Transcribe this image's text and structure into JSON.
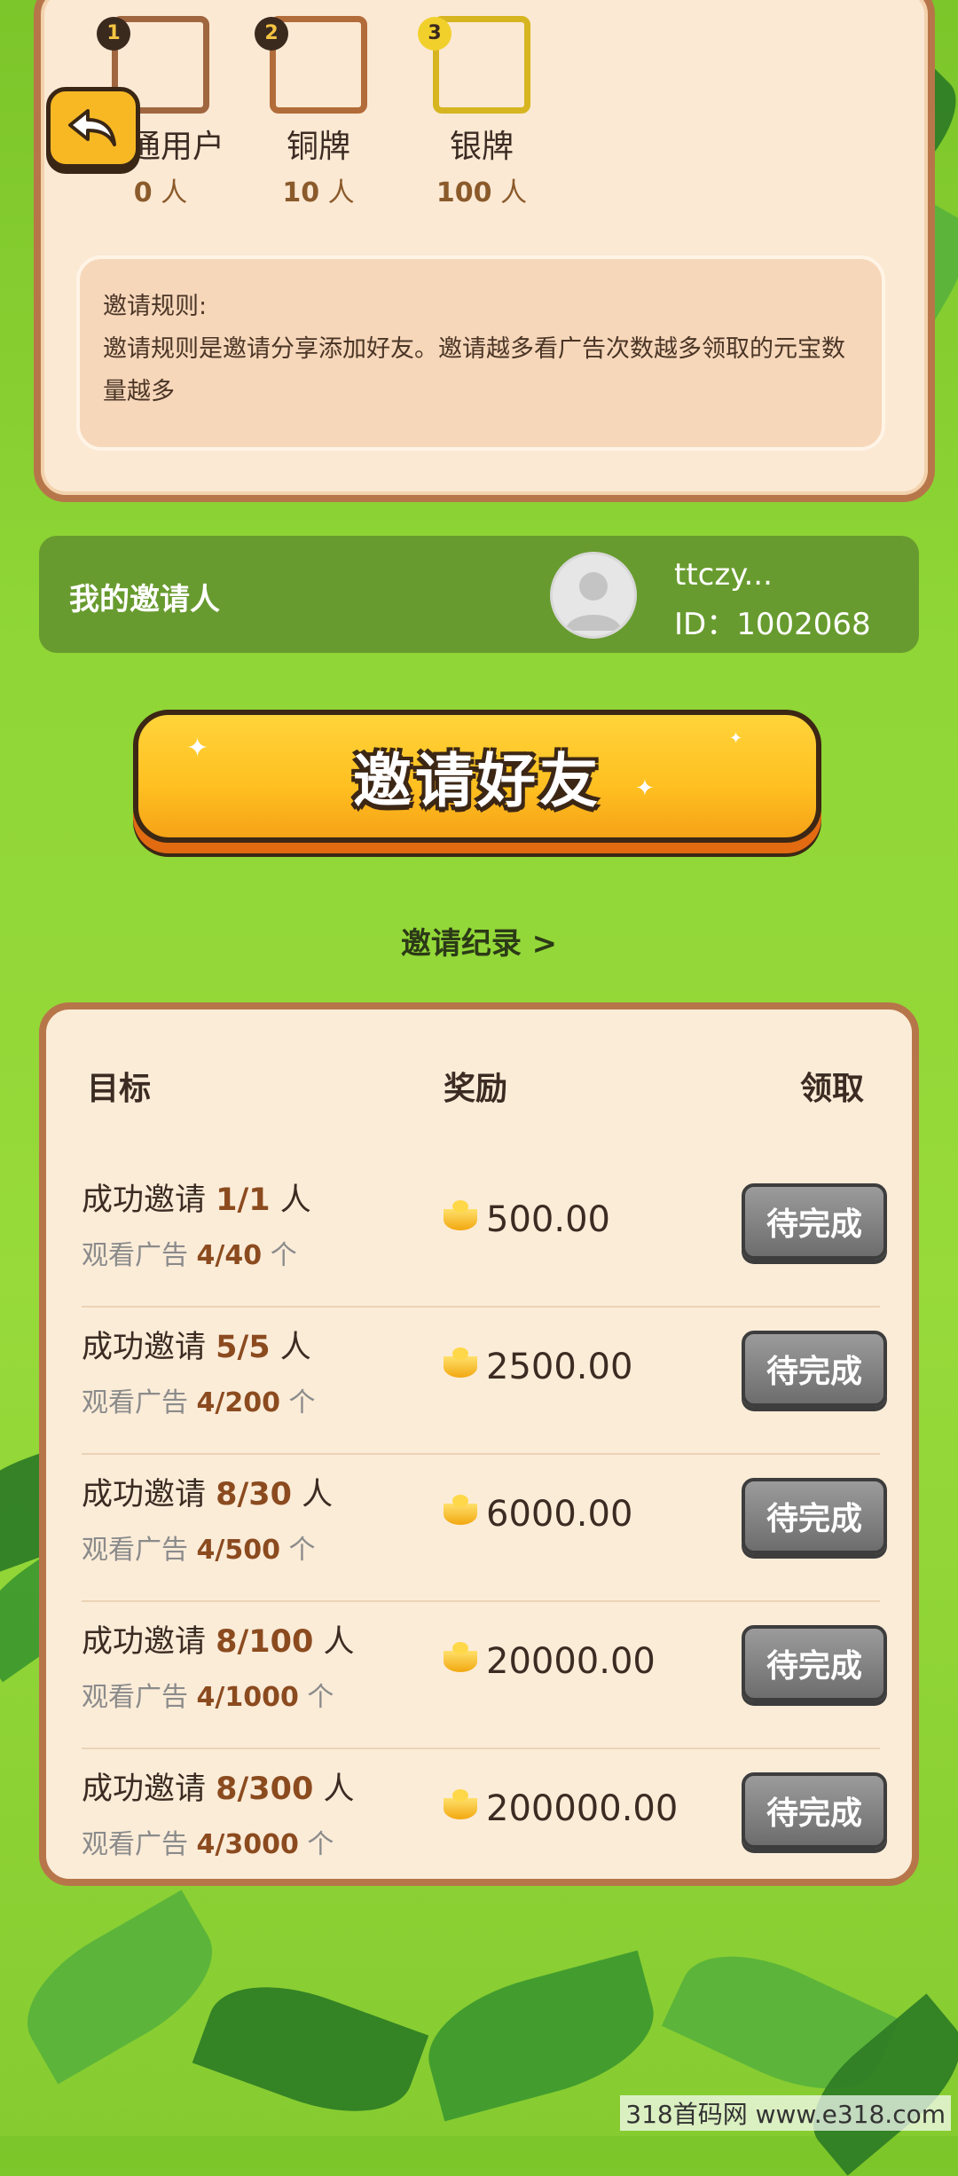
{
  "levels": [
    {
      "rank": "1",
      "name": "普通用户",
      "count": "0",
      "unit": "人"
    },
    {
      "rank": "2",
      "name": "铜牌",
      "count": "10",
      "unit": "人"
    },
    {
      "rank": "3",
      "name": "银牌",
      "count": "100",
      "unit": "人"
    }
  ],
  "rules": {
    "title": "邀请规则:",
    "text": "邀请规则是邀请分享添加好友。邀请越多看广告次数越多领取的元宝数量越多"
  },
  "inviter": {
    "label": "我的邀请人",
    "name": "ttczy...",
    "id": "ID：1002068"
  },
  "invite_button": "邀请好友",
  "record_link": "邀请纪录 >",
  "table": {
    "headers": {
      "goal": "目标",
      "reward": "奖励",
      "claim": "领取"
    },
    "rows": [
      {
        "goal_prefix": "成功邀请",
        "goal_value": "1/1",
        "goal_unit": "人",
        "sub_prefix": "观看广告",
        "sub_value": "4/40",
        "sub_unit": "个",
        "reward": "500.00",
        "claim": "待完成"
      },
      {
        "goal_prefix": "成功邀请",
        "goal_value": "5/5",
        "goal_unit": "人",
        "sub_prefix": "观看广告",
        "sub_value": "4/200",
        "sub_unit": "个",
        "reward": "2500.00",
        "claim": "待完成"
      },
      {
        "goal_prefix": "成功邀请",
        "goal_value": "8/30",
        "goal_unit": "人",
        "sub_prefix": "观看广告",
        "sub_value": "4/500",
        "sub_unit": "个",
        "reward": "6000.00",
        "claim": "待完成"
      },
      {
        "goal_prefix": "成功邀请",
        "goal_value": "8/100",
        "goal_unit": "人",
        "sub_prefix": "观看广告",
        "sub_value": "4/1000",
        "sub_unit": "个",
        "reward": "20000.00",
        "claim": "待完成"
      },
      {
        "goal_prefix": "成功邀请",
        "goal_value": "8/300",
        "goal_unit": "人",
        "sub_prefix": "观看广告",
        "sub_value": "4/3000",
        "sub_unit": "个",
        "reward": "200000.00",
        "claim": "待完成"
      }
    ]
  },
  "watermark": "318首码网 www.e318.com",
  "colors": {
    "accent": "#f7b824",
    "card_border": "#b7764a",
    "background": "#8fd636"
  }
}
